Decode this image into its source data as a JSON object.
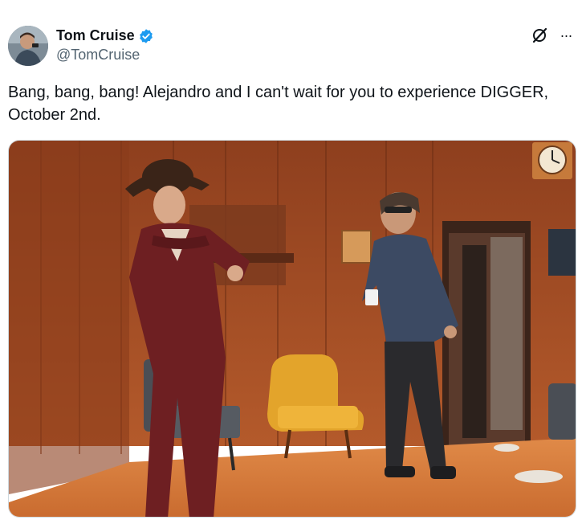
{
  "author": {
    "display_name": "Tom Cruise",
    "handle": "@TomCruise",
    "verified": true,
    "verified_color": "#1d9bf0"
  },
  "icons": {
    "grok": "grok-icon",
    "more": "more-options-icon",
    "more_glyph": "···"
  },
  "tweet": {
    "text": "Bang, bang, bang! Alejandro and I can't wait for you to experience DIGGER, October 2nd."
  },
  "media": {
    "type": "photo",
    "palette": {
      "wall": "#a9532a",
      "floor": "#d97a3c",
      "chair": "#e2a32c",
      "suit": "#6e1f22"
    }
  }
}
